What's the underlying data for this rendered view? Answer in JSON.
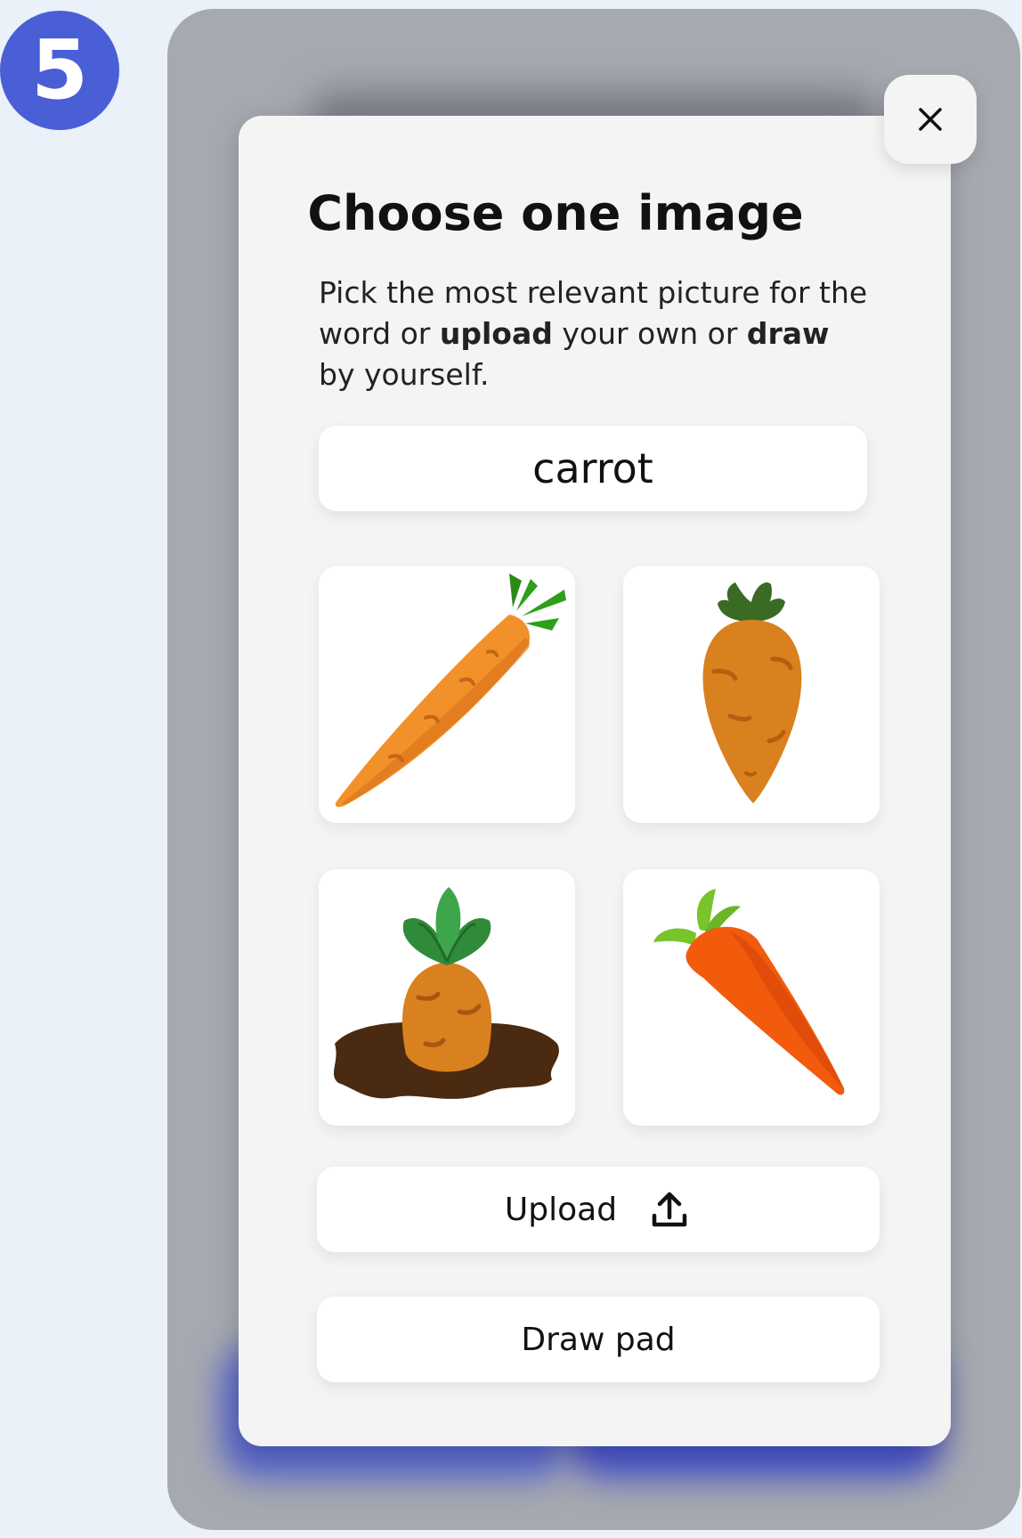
{
  "step": {
    "number": "5"
  },
  "modal": {
    "close_icon": "close-icon",
    "title": "Choose one image",
    "instructions": {
      "part1": "Pick the most relevant picture for the word or ",
      "bold1": "upload",
      "part2": " your own or ",
      "bold2": "draw",
      "part3": " by yourself."
    },
    "word": "carrot",
    "image_options": [
      {
        "depicts": "long orange carrot with green leaves"
      },
      {
        "depicts": "short rounded carrot with dark green top"
      },
      {
        "depicts": "carrot growing in dirt with green leaves"
      },
      {
        "depicts": "bright red-orange carrot with green stem"
      }
    ],
    "upload_label": "Upload",
    "upload_icon": "upload-icon",
    "draw_label": "Draw pad"
  },
  "colors": {
    "badge": "#4a5fd6",
    "overlay": "#a6a9b0",
    "modal_bg": "#f4f4f4",
    "card_bg": "#ffffff",
    "background": "#eaf1f9"
  }
}
